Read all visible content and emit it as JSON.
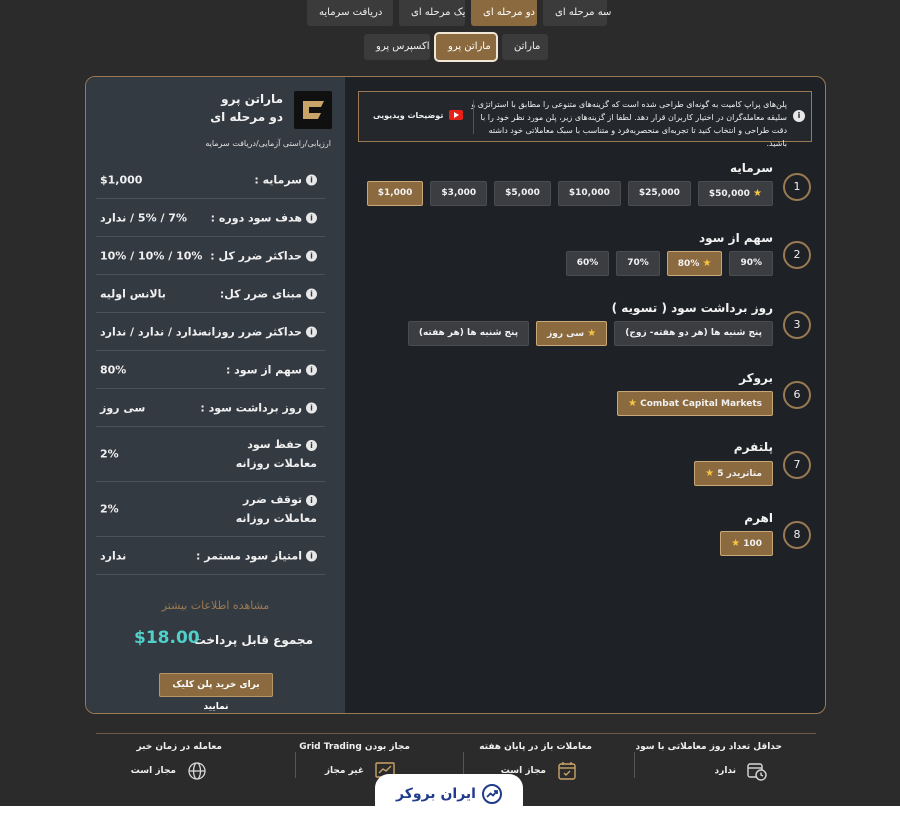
{
  "tabs_top": [
    "دریافت سرمایه",
    "یک مرحله ای",
    "دو مرحله ای",
    "سه مرحله ای"
  ],
  "tabs_top_active": 2,
  "tabs_sub": [
    "اکسپرس پرو",
    "ماراتن پرو",
    "ماراتن"
  ],
  "tabs_sub_active": 1,
  "summary": {
    "plan_name": "ماراتن پرو",
    "plan_type": "دو مرحله ای",
    "steps": "ارزیابی/راستی آزمایی/دریافت سرمایه",
    "rows": [
      {
        "label": "سرمایه :",
        "value": "$1,000"
      },
      {
        "label": "هدف سود دوره :",
        "value": "7% / 5% / ندارد"
      },
      {
        "label": "حداکثر ضرر کل :",
        "value": "10% / 10% / 10%"
      },
      {
        "label": "مبنای ضرر کل:",
        "value": "بالانس اولیه"
      },
      {
        "label": "حداکثر ضرر روزانه :",
        "value": "ندارد / ندارد / ندارد"
      },
      {
        "label": "سهم از سود :",
        "value": "80%"
      },
      {
        "label": "روز برداشت سود :",
        "value": "سی روز"
      },
      {
        "label": "حفظ سود معاملات روزانه",
        "value": "2%"
      },
      {
        "label": "توقف ضرر معاملات روزانه",
        "value": "2%"
      },
      {
        "label": "امتیاز سود مستمر :",
        "value": "ندارد"
      }
    ],
    "more": "مشاهده اطلاعات بیشتر",
    "total_label": "مجموع قابل پرداخت",
    "total_value": "$18.00",
    "buy_label": "برای خرید پلن کلیک نمایید"
  },
  "info": {
    "text": "پلن‌های پراپ کامیت به گونه‌ای طراحی شده است که گزینه‌های متنوعی را مطابق با استراتژی و سلیقه معامله‌گران در اختیار کاربران قرار دهد. لطفا از گزینه‌های زیر، پلن مورد نظر خود را با دقت طراحی و انتخاب کنید تا تجربه‌ای منحصربه‌فرد و متناسب با سبک معاملاتی خود داشته باشید.",
    "video_label": "توضیحات ویدیویی"
  },
  "steps": [
    {
      "num": "1",
      "title": "سرمایه",
      "options": [
        "$50,000",
        "$25,000",
        "$10,000",
        "$5,000",
        "$3,000",
        "$1,000"
      ],
      "starred": 0,
      "selected": 5
    },
    {
      "num": "2",
      "title": "سهم از سود",
      "options": [
        "90%",
        "80%",
        "70%",
        "60%"
      ],
      "starred": 1,
      "selected": 1
    },
    {
      "num": "3",
      "title": "روز برداشت سود ( تسویه )",
      "options": [
        "پنج شنبه ها (هر دو هفته- زوج)",
        "سی روز",
        "پنج شنبه ها (هر هفته)"
      ],
      "starred": 1,
      "selected": 1
    },
    {
      "num": "6",
      "title": "بروکر",
      "options": [
        "Combat Capital Markets"
      ],
      "starred": 0,
      "selected": 0
    },
    {
      "num": "7",
      "title": "پلتفرم",
      "options": [
        "متاتریدر 5"
      ],
      "starred": 0,
      "selected": 0
    },
    {
      "num": "8",
      "title": "اهرم",
      "options": [
        "100"
      ],
      "starred": 0,
      "selected": 0
    }
  ],
  "features": [
    {
      "title": "حداقل تعداد روز معاملاتی با سود",
      "value": "ندارد",
      "icon": "calendar-clock-icon"
    },
    {
      "title": "معاملات باز در پایان هفته",
      "value": "مجاز است",
      "icon": "calendar-check-icon"
    },
    {
      "title": "مجاز بودن Grid Trading",
      "value": "غیر مجاز",
      "icon": "chart-line-icon"
    },
    {
      "title": "معامله در زمان خبر",
      "value": "مجاز است",
      "icon": "globe-icon"
    }
  ],
  "brand": "ایران بروکر",
  "colors": {
    "accent": "#8b6a3f",
    "border": "#9a7a52",
    "total": "#4fd0c8",
    "star": "#f5c542"
  }
}
